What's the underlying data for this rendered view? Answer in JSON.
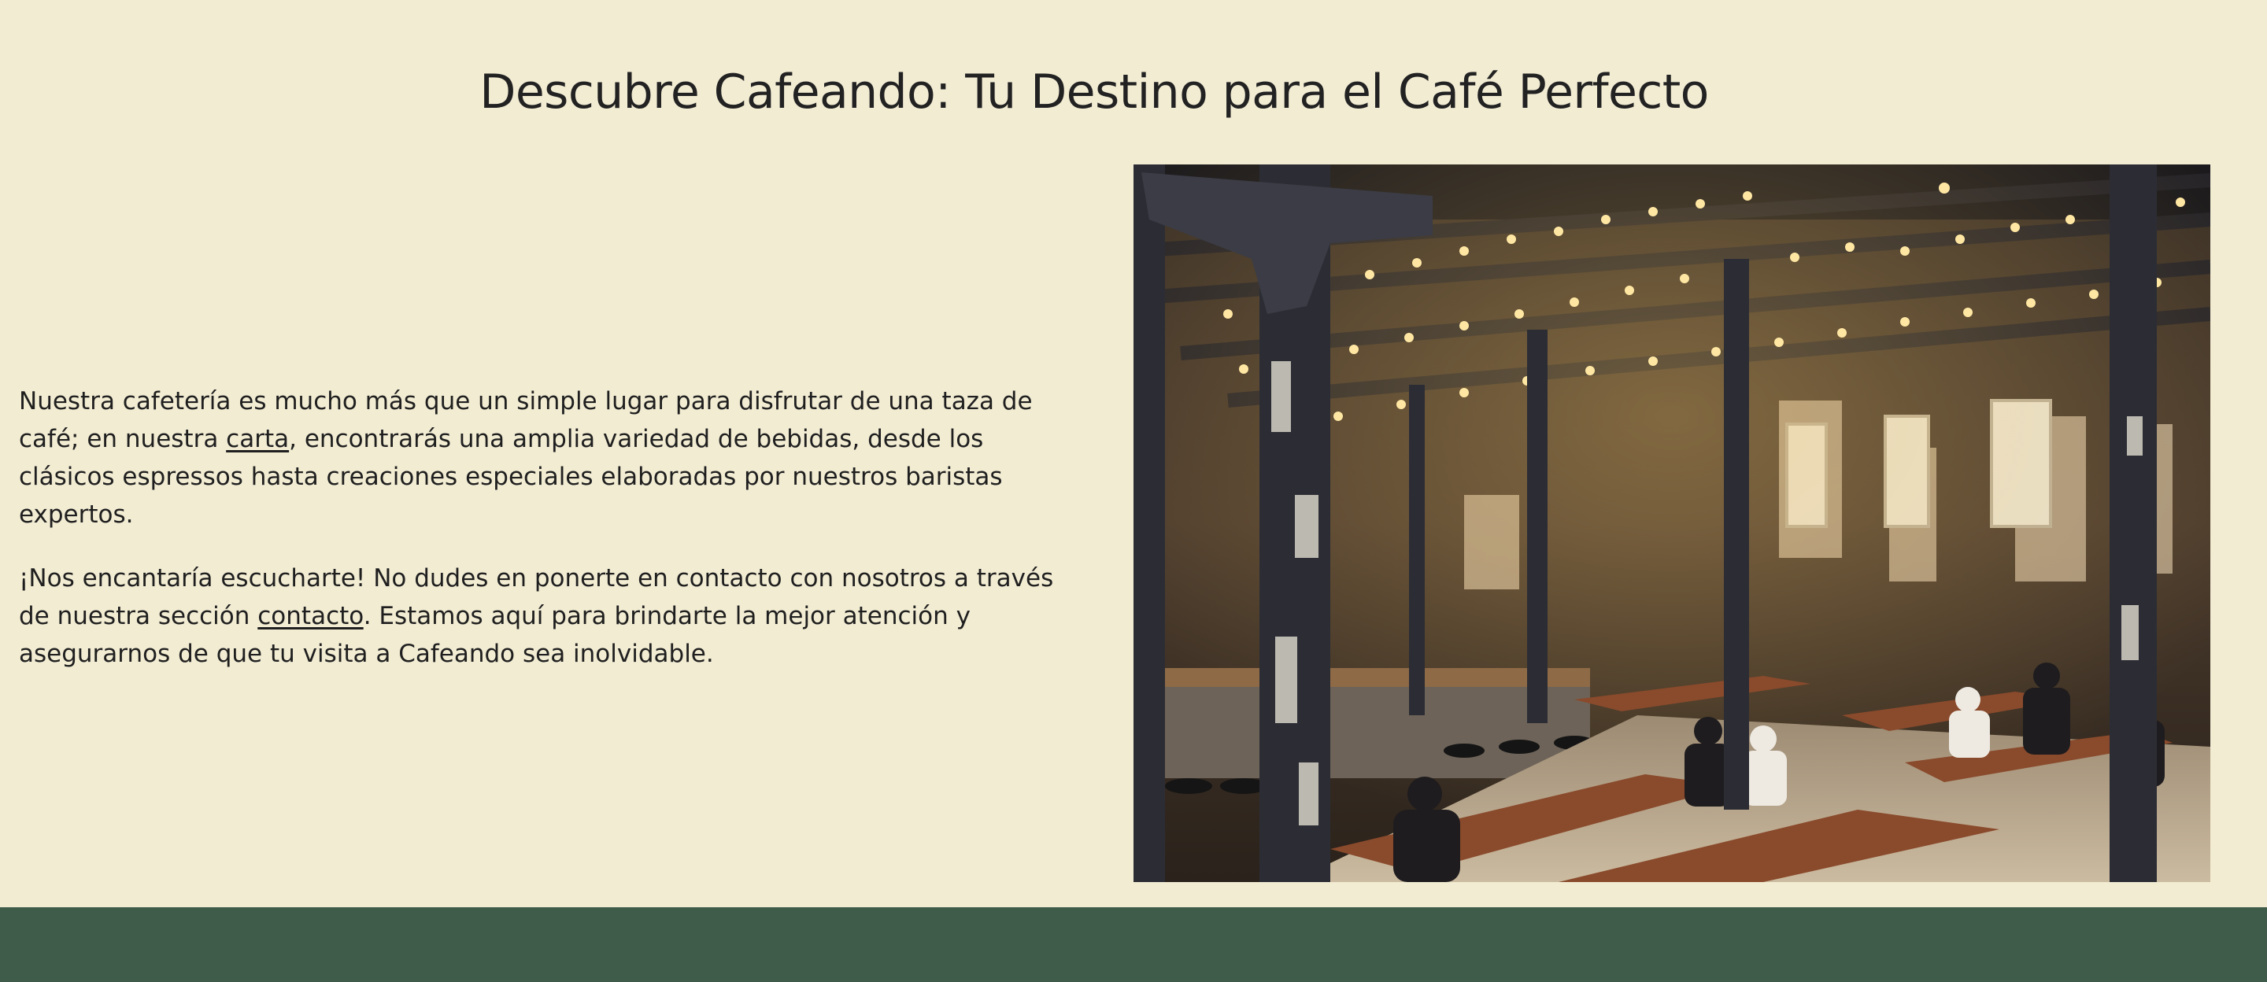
{
  "page": {
    "title": "Descubre Cafeando: Tu Destino para el Café Perfecto"
  },
  "intro": {
    "paragraph1": {
      "before_link": "Nuestra cafetería es mucho más que un simple lugar para disfrutar de una taza de café; en nuestra ",
      "link_text": "carta",
      "after_link": ", encontrarás una amplia variedad de bebidas, desde los clásicos espressos hasta creaciones especiales elaboradas por nuestros baristas expertos."
    },
    "paragraph2": {
      "before_link": "¡Nos encantaría escucharte! No dudes en ponerte en contacto con nosotros a través de nuestra sección ",
      "link_text": "contacto",
      "after_link": ". Estamos aquí para brindarte la mejor atención y asegurarnos de que tu visita a Cafeando sea inolvidable."
    }
  },
  "colors": {
    "background": "#f2ecd3",
    "text": "#222222",
    "footer": "#3f5b49"
  }
}
